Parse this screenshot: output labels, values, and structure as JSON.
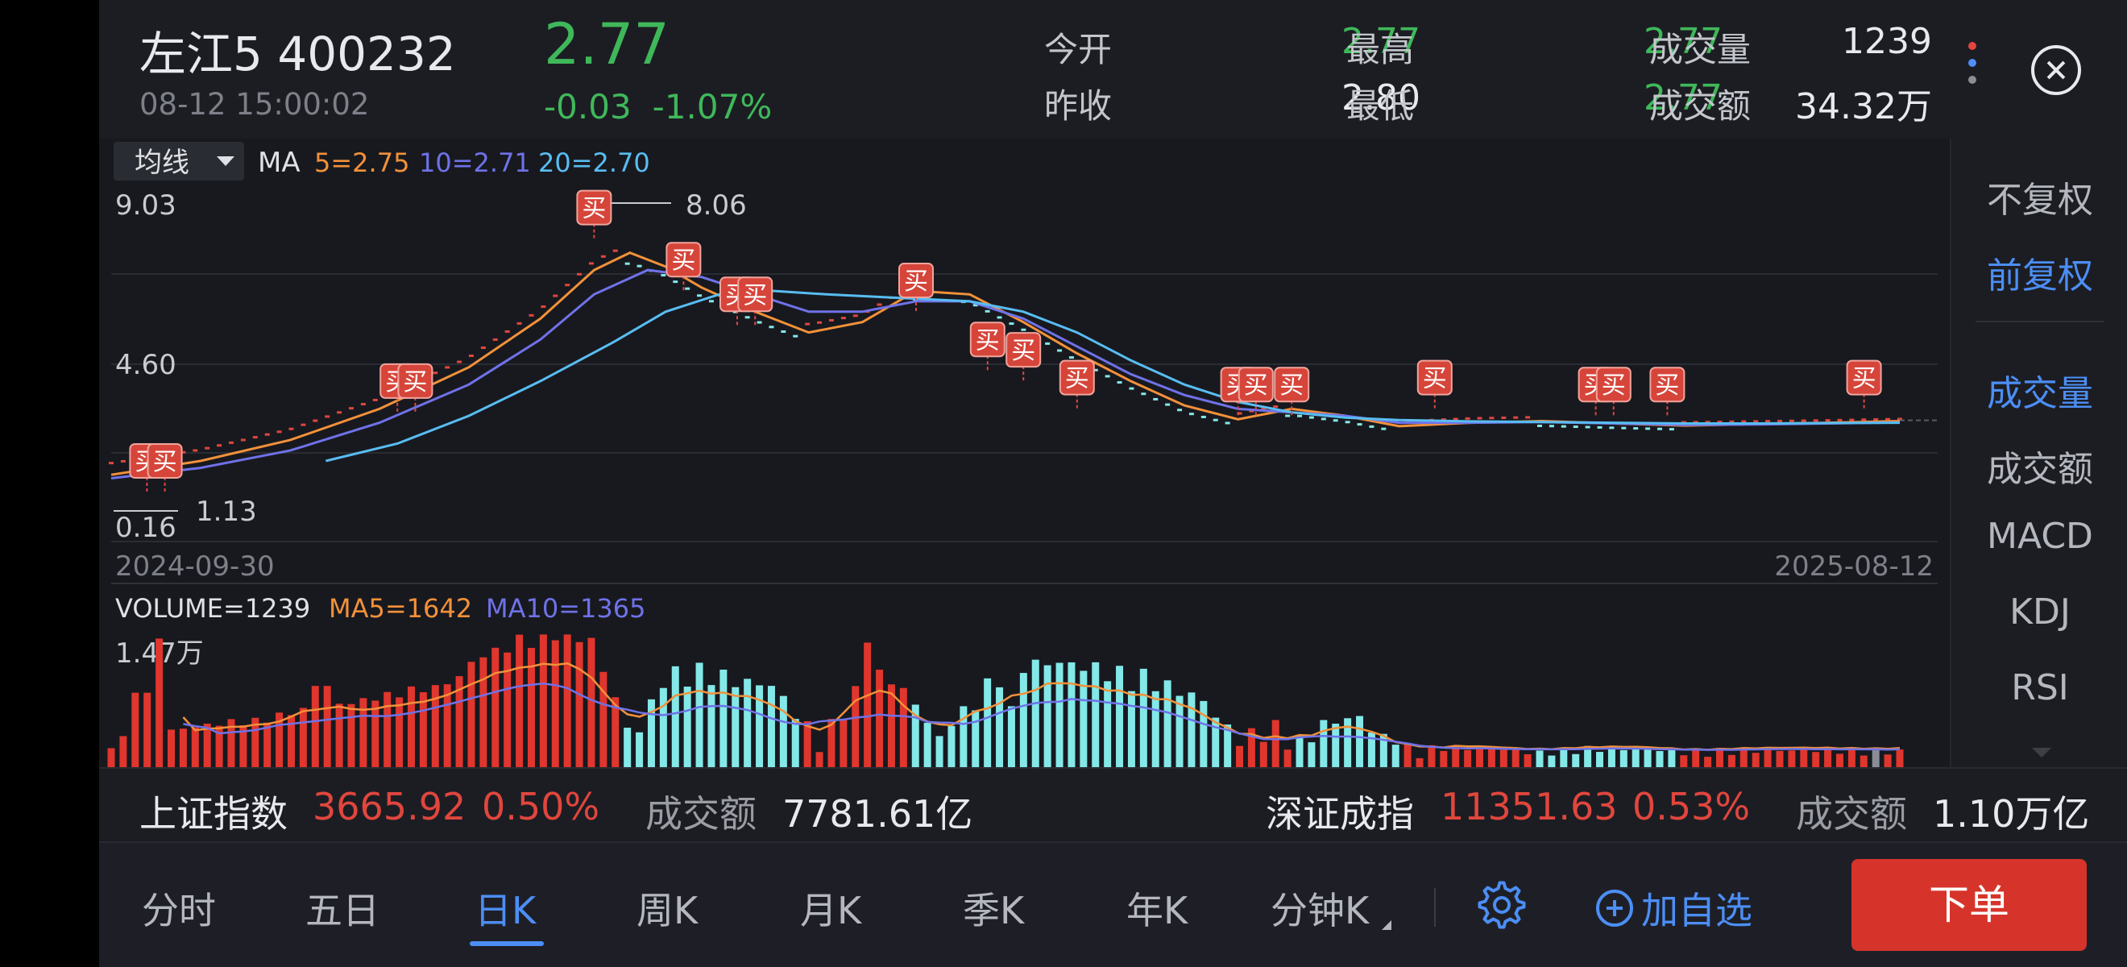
{
  "header": {
    "name": "左江5 400232",
    "datetime": "08-12 15:00:02",
    "price": "2.77",
    "change": "-0.03",
    "change_pct": "-1.07%",
    "open_label": "今开",
    "open": "2.77",
    "high_label": "最高",
    "high": "2.77",
    "volume_label": "成交量",
    "volume": "1239",
    "prev_close_label": "昨收",
    "prev_close": "2.80",
    "low_label": "最低",
    "low": "2.77",
    "turnover_label": "成交额",
    "turnover": "34.32万"
  },
  "colors": {
    "up": "#e0463d",
    "down": "#3fb85a",
    "accent": "#4c8ef5",
    "ma5": "#f2913a",
    "ma10": "#6f72e8",
    "ma20": "#58bdf2",
    "down_bar": "#84e8e8"
  },
  "chart": {
    "indicator_select": "均线",
    "ma_label": "MA",
    "ma5_text": "5=2.75",
    "ma10_text": "10=2.71",
    "ma20_text": "20=2.70",
    "y_top": "9.03",
    "y_mid": "4.60",
    "y_bottom": "0.16",
    "max_label": "8.06",
    "min_label": "1.13",
    "date_start": "2024-09-30",
    "date_end": "2025-08-12",
    "volume_text": "VOLUME=1239",
    "vma5_text": "MA5=1642",
    "vma10_text": "MA10=1365",
    "volume_axis": "1.47万",
    "buy_label": "买"
  },
  "chart_data": {
    "type": "line",
    "title": "",
    "x_range": [
      "2024-09-30",
      "2025-08-12"
    ],
    "y_range": [
      0.16,
      9.03
    ],
    "y_ticks": [
      9.03,
      4.6,
      0.16
    ],
    "series": [
      {
        "name": "MA5",
        "last": 2.75,
        "points": [
          [
            0,
            1.2
          ],
          [
            0.05,
            1.6
          ],
          [
            0.1,
            2.2
          ],
          [
            0.15,
            3.1
          ],
          [
            0.2,
            4.3
          ],
          [
            0.24,
            5.7
          ],
          [
            0.27,
            7.1
          ],
          [
            0.29,
            7.6
          ],
          [
            0.31,
            7.2
          ],
          [
            0.33,
            6.6
          ],
          [
            0.36,
            5.9
          ],
          [
            0.39,
            5.3
          ],
          [
            0.42,
            5.6
          ],
          [
            0.45,
            6.5
          ],
          [
            0.48,
            6.4
          ],
          [
            0.51,
            5.6
          ],
          [
            0.54,
            4.7
          ],
          [
            0.57,
            3.9
          ],
          [
            0.6,
            3.2
          ],
          [
            0.63,
            2.8
          ],
          [
            0.66,
            3.1
          ],
          [
            0.69,
            2.9
          ],
          [
            0.72,
            2.6
          ],
          [
            0.76,
            2.7
          ],
          [
            0.8,
            2.75
          ],
          [
            0.84,
            2.68
          ],
          [
            0.88,
            2.62
          ],
          [
            0.92,
            2.66
          ],
          [
            0.96,
            2.7
          ],
          [
            1,
            2.75
          ]
        ]
      },
      {
        "name": "MA10",
        "last": 2.71,
        "points": [
          [
            0,
            1.1
          ],
          [
            0.05,
            1.4
          ],
          [
            0.1,
            1.9
          ],
          [
            0.15,
            2.7
          ],
          [
            0.2,
            3.8
          ],
          [
            0.24,
            5.1
          ],
          [
            0.27,
            6.4
          ],
          [
            0.3,
            7.1
          ],
          [
            0.33,
            6.9
          ],
          [
            0.36,
            6.4
          ],
          [
            0.39,
            5.9
          ],
          [
            0.42,
            5.9
          ],
          [
            0.45,
            6.2
          ],
          [
            0.48,
            6.2
          ],
          [
            0.51,
            5.7
          ],
          [
            0.54,
            4.9
          ],
          [
            0.57,
            4.1
          ],
          [
            0.6,
            3.5
          ],
          [
            0.63,
            3.1
          ],
          [
            0.66,
            3.0
          ],
          [
            0.69,
            2.9
          ],
          [
            0.72,
            2.7
          ],
          [
            0.76,
            2.7
          ],
          [
            0.8,
            2.72
          ],
          [
            0.84,
            2.68
          ],
          [
            0.88,
            2.64
          ],
          [
            0.92,
            2.65
          ],
          [
            0.96,
            2.68
          ],
          [
            1,
            2.71
          ]
        ]
      },
      {
        "name": "MA20",
        "last": 2.7,
        "points": [
          [
            0.12,
            1.6
          ],
          [
            0.16,
            2.1
          ],
          [
            0.2,
            2.9
          ],
          [
            0.24,
            3.9
          ],
          [
            0.28,
            5.0
          ],
          [
            0.31,
            5.9
          ],
          [
            0.34,
            6.4
          ],
          [
            0.37,
            6.5
          ],
          [
            0.4,
            6.4
          ],
          [
            0.44,
            6.3
          ],
          [
            0.48,
            6.2
          ],
          [
            0.51,
            5.9
          ],
          [
            0.54,
            5.3
          ],
          [
            0.57,
            4.5
          ],
          [
            0.6,
            3.8
          ],
          [
            0.63,
            3.3
          ],
          [
            0.66,
            3.0
          ],
          [
            0.69,
            2.85
          ],
          [
            0.72,
            2.78
          ],
          [
            0.76,
            2.74
          ],
          [
            0.8,
            2.72
          ],
          [
            0.84,
            2.7
          ],
          [
            0.88,
            2.68
          ],
          [
            0.92,
            2.68
          ],
          [
            0.96,
            2.69
          ],
          [
            1,
            2.7
          ]
        ]
      }
    ],
    "buy_markers": [
      [
        0.02,
        1.6
      ],
      [
        0.03,
        1.6
      ],
      [
        0.16,
        3.9
      ],
      [
        0.17,
        3.9
      ],
      [
        0.27,
        8.9
      ],
      [
        0.32,
        7.4
      ],
      [
        0.35,
        6.4
      ],
      [
        0.36,
        6.4
      ],
      [
        0.45,
        6.8
      ],
      [
        0.49,
        5.1
      ],
      [
        0.51,
        4.8
      ],
      [
        0.54,
        4.0
      ],
      [
        0.63,
        3.8
      ],
      [
        0.64,
        3.8
      ],
      [
        0.66,
        3.8
      ],
      [
        0.74,
        4.0
      ],
      [
        0.83,
        3.8
      ],
      [
        0.84,
        3.8
      ],
      [
        0.87,
        3.8
      ],
      [
        0.98,
        4.0
      ]
    ],
    "volume": {
      "max_label": "1.47万",
      "last": 1239,
      "ma5": 1642,
      "ma10": 1365
    }
  },
  "side": {
    "items": [
      "不复权",
      "前复权",
      "成交量",
      "成交额",
      "MACD",
      "KDJ",
      "RSI"
    ]
  },
  "index_bar": {
    "sh_name": "上证指数",
    "sh_value": "3665.92",
    "sh_pct": "0.50%",
    "sh_turnover_label": "成交额",
    "sh_turnover": "7781.61亿",
    "sz_name": "深证成指",
    "sz_value": "11351.63",
    "sz_pct": "0.53%",
    "sz_turnover_label": "成交额",
    "sz_turnover": "1.10万亿"
  },
  "tabs": {
    "items": [
      "分时",
      "五日",
      "日K",
      "周K",
      "月K",
      "季K",
      "年K",
      "分钟K"
    ],
    "add_fav": "加自选",
    "order": "下单"
  }
}
